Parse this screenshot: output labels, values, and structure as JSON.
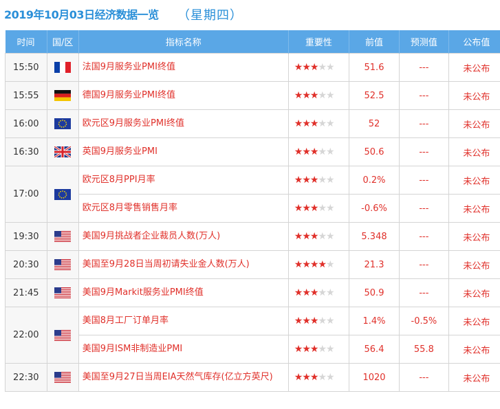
{
  "header": {
    "date_title": "2019年10月03日经济数据一览",
    "weekday": "星期四",
    "paren_open": "（",
    "paren_close": "）"
  },
  "columns": [
    "时间",
    "国/区",
    "指标名称",
    "重要性",
    "前值",
    "预测值",
    "公布值"
  ],
  "flag_icons": {
    "fr": "france-flag-icon",
    "de": "germany-flag-icon",
    "eu": "eu-flag-icon",
    "gb": "uk-flag-icon",
    "us": "us-flag-icon"
  },
  "groups": [
    {
      "time": "15:50",
      "flag": "fr",
      "rows": [
        {
          "name": "法国9月服务业PMI终值",
          "stars": 3,
          "previous": "51.6",
          "forecast": "---",
          "actual": "未公布"
        }
      ]
    },
    {
      "time": "15:55",
      "flag": "de",
      "rows": [
        {
          "name": "德国9月服务业PMI终值",
          "stars": 3,
          "previous": "52.5",
          "forecast": "---",
          "actual": "未公布"
        }
      ]
    },
    {
      "time": "16:00",
      "flag": "eu",
      "rows": [
        {
          "name": "欧元区9月服务业PMI终值",
          "stars": 3,
          "previous": "52",
          "forecast": "---",
          "actual": "未公布"
        }
      ]
    },
    {
      "time": "16:30",
      "flag": "gb",
      "rows": [
        {
          "name": "英国9月服务业PMI",
          "stars": 3,
          "previous": "50.6",
          "forecast": "---",
          "actual": "未公布"
        }
      ]
    },
    {
      "time": "17:00",
      "flag": "eu",
      "rows": [
        {
          "name": "欧元区8月PPI月率",
          "stars": 3,
          "previous": "0.2%",
          "forecast": "---",
          "actual": "未公布"
        },
        {
          "name": "欧元区8月零售销售月率",
          "stars": 3,
          "previous": "-0.6%",
          "forecast": "---",
          "actual": "未公布"
        }
      ]
    },
    {
      "time": "19:30",
      "flag": "us",
      "rows": [
        {
          "name": "美国9月挑战者企业裁员人数(万人)",
          "stars": 3,
          "previous": "5.348",
          "forecast": "---",
          "actual": "未公布"
        }
      ]
    },
    {
      "time": "20:30",
      "flag": "us",
      "rows": [
        {
          "name": "美国至9月28日当周初请失业金人数(万人)",
          "stars": 4,
          "previous": "21.3",
          "forecast": "---",
          "actual": "未公布"
        }
      ]
    },
    {
      "time": "21:45",
      "flag": "us",
      "rows": [
        {
          "name": "美国9月Markit服务业PMI终值",
          "stars": 3,
          "previous": "50.9",
          "forecast": "---",
          "actual": "未公布"
        }
      ]
    },
    {
      "time": "22:00",
      "flag": "us",
      "rows": [
        {
          "name": "美国8月工厂订单月率",
          "stars": 3,
          "previous": "1.4%",
          "forecast": "-0.5%",
          "actual": "未公布"
        },
        {
          "name": "美国9月ISM非制造业PMI",
          "stars": 3,
          "previous": "56.4",
          "forecast": "55.8",
          "actual": "未公布"
        }
      ]
    },
    {
      "time": "22:30",
      "flag": "us",
      "rows": [
        {
          "name": "美国至9月27日当周EIA天然气库存(亿立方英尺)",
          "stars": 3,
          "previous": "1020",
          "forecast": "---",
          "actual": "未公布"
        }
      ]
    }
  ],
  "star_max": 5,
  "colors": {
    "header_bg": "#5aa7e6",
    "accent_red": "#e0302a",
    "title_blue": "#2a8fd8"
  }
}
